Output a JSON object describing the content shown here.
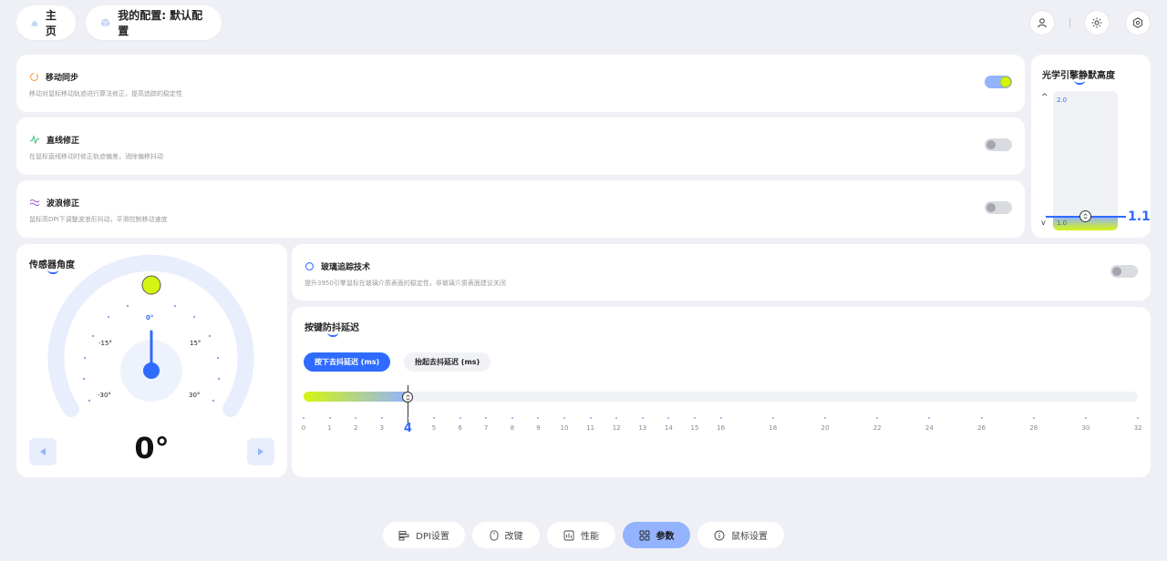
{
  "header": {
    "home_label": "主页",
    "config_label": "我的配置: 默认配置"
  },
  "features": [
    {
      "title": "移动同步",
      "desc": "移动对鼠标移动轨迹进行算法修正，提高追踪的稳定性",
      "on": true,
      "icon": "sync-icon",
      "color": "#f0a14a"
    },
    {
      "title": "直线修正",
      "desc": "在鼠标直线移动时修正轨迹偏差，消除偏移抖动",
      "on": false,
      "icon": "line-correction-icon",
      "color": "#3bbf7a"
    },
    {
      "title": "波浪修正",
      "desc": "鼠标高DPI下调整波浪形抖动，平滑控制移动速度",
      "on": false,
      "icon": "wave-icon",
      "color": "#9b59d6"
    }
  ],
  "lod": {
    "title": "光学引擎静默高度",
    "max_label": "2.0",
    "min_label": "1.0",
    "up_arrow": "^",
    "down_arrow": "v",
    "value": "1.1",
    "min": 1.0,
    "max": 2.0
  },
  "sensor": {
    "title": "传感器角度",
    "zero_label": "0°",
    "left15": "-15°",
    "right15": "15°",
    "left30": "-30°",
    "right30": "30°",
    "value": "0°"
  },
  "glass": {
    "title": "玻璃追踪技术",
    "desc": "提升3950引擎鼠标在玻璃介质表面的稳定性，非玻璃介质表面建议关闭",
    "on": false
  },
  "debounce": {
    "title": "按键防抖延迟",
    "tab_press": "按下去抖延迟 (ms)",
    "tab_release": "抬起去抖延迟 (ms)",
    "current": "4",
    "value": 4,
    "min": 0,
    "max": 32,
    "ticks": [
      "0",
      "1",
      "2",
      "3",
      "4",
      "5",
      "6",
      "7",
      "8",
      "9",
      "10",
      "11",
      "12",
      "13",
      "14",
      "15",
      "16",
      "18",
      "20",
      "22",
      "24",
      "26",
      "28",
      "30",
      "32"
    ]
  },
  "bottom_nav": [
    {
      "label": "DPI设置",
      "icon": "dpi-icon",
      "active": false
    },
    {
      "label": "改键",
      "icon": "mouse-icon",
      "active": false
    },
    {
      "label": "性能",
      "icon": "performance-icon",
      "active": false
    },
    {
      "label": "参数",
      "icon": "params-icon",
      "active": true
    },
    {
      "label": "鼠标设置",
      "icon": "info-icon",
      "active": false
    }
  ],
  "colors": {
    "accent": "#2f6bff",
    "accent_light": "#93b3ff",
    "lime": "#d4f511"
  }
}
